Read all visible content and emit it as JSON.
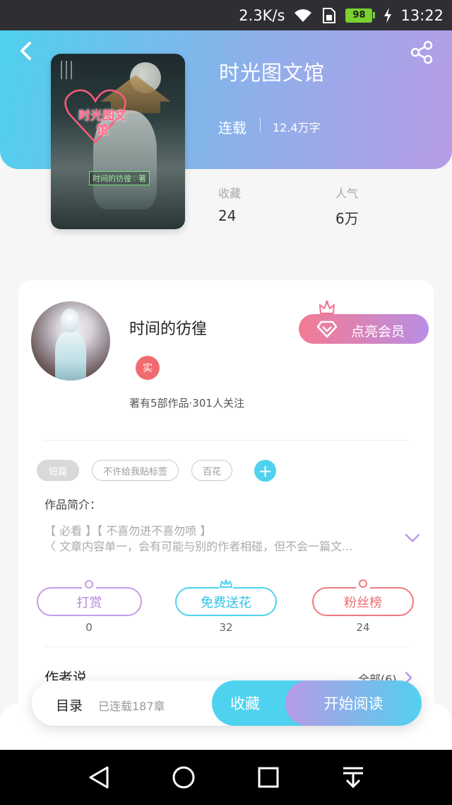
{
  "status_bar": {
    "network_speed": "2.3K/s",
    "battery_level": "98",
    "time": "13:22",
    "icons": [
      "wifi-icon",
      "sim-icon",
      "battery-icon",
      "charging-icon"
    ]
  },
  "header": {
    "back_icon": "back-icon",
    "share_icon": "share-icon"
  },
  "book": {
    "title": "时光图文馆",
    "status": "连载",
    "word_count": "12.4万字",
    "cover_title": "时光图文馆",
    "cover_subtitle": "时间的彷徨♡著"
  },
  "stats": {
    "favorites_label": "收藏",
    "favorites_value": "24",
    "popularity_label": "人气",
    "popularity_value": "6万"
  },
  "author": {
    "name": "时间的彷徨",
    "badge": "实",
    "stats_text": "著有5部作品·301人关注",
    "vip_button": "点亮会员"
  },
  "tags": [
    "短篇",
    "不许给我贴标签",
    "百花"
  ],
  "intro": {
    "label": "作品简介：",
    "line1": "【 必看 】【 不喜勿进不喜勿喷 】",
    "line2": "〈 文章内容单一，会有可能与别的作者相碰，但不会一篇文..."
  },
  "actions": [
    {
      "label": "打赏",
      "count": "0"
    },
    {
      "label": "免费送花",
      "count": "32"
    },
    {
      "label": "粉丝榜",
      "count": "24"
    }
  ],
  "author_says": {
    "title": "作者说",
    "all_link": "全部(6)"
  },
  "bottom_bar": {
    "toc": "目录",
    "chapters": "已连载187章",
    "collect": "收藏",
    "read": "开始阅读"
  },
  "colors": {
    "header_gradient_start": "#4fd0ef",
    "header_gradient_end": "#b79ce6",
    "accent_cyan": "#4fd2ef",
    "accent_purple": "#b98ee4",
    "accent_red": "#f06b70"
  }
}
